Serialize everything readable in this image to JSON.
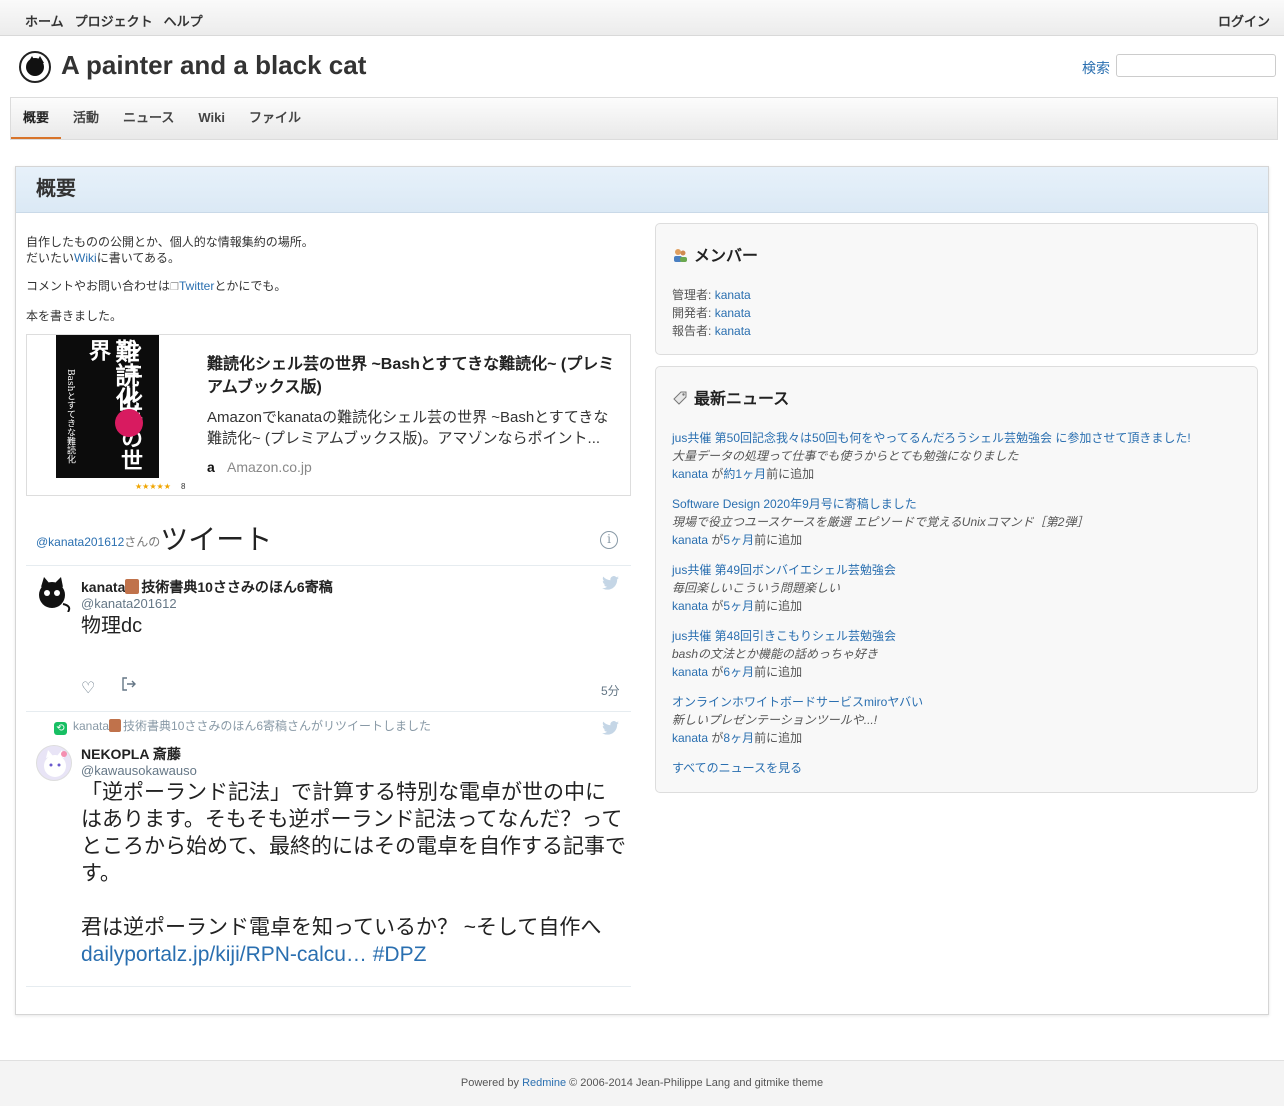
{
  "top_menu": {
    "items": [
      "ホーム",
      "プロジェクト",
      "ヘルプ"
    ],
    "login": "ログイン"
  },
  "header": {
    "title": "A painter and a black cat",
    "search_label": "検索",
    "search_value": ""
  },
  "main_menu": {
    "tabs": [
      "概要",
      "活動",
      "ニュース",
      "Wiki",
      "ファイル"
    ],
    "active": "概要"
  },
  "page": {
    "heading": "概要"
  },
  "description": {
    "line1": "自作したものの公開とか、個人的な情報集約の場所。",
    "line2_pre": "だいたい",
    "line2_link": "Wiki",
    "line2_post": "に書いてある。",
    "line3_pre": "コメントやお問い合わせは",
    "line3_link": "Twitter",
    "line3_post": "とかにでも。",
    "line4": "本を書きました。"
  },
  "book": {
    "title": "難読化シェル芸の世界 ~Bashとすてきな難読化~ (プレミアムブックス版)",
    "description": "Amazonでkanataの難読化シェル芸の世界 ~Bashとすてきな難読化~ (プレミアムブックス版)。アマゾンならポイント...",
    "source": "Amazon.co.jp",
    "cover_title": "難読化",
    "cover_title2": "シェル芸の世界",
    "cover_sub": "Bashとすてきな難読化",
    "stars": "★★★★★",
    "rating_count": "8"
  },
  "twitter": {
    "handle_link": "@kanata201612",
    "handle_suffix": "さんの",
    "title": "ツイート",
    "tweets": [
      {
        "name": "kanata",
        "name_suffix": "技術書典10ささみのほん6寄稿",
        "handle": "@kanata201612",
        "text": "物理dc",
        "time": "5分"
      },
      {
        "retweet_by": "kanata",
        "retweet_suffix": "技術書典10ささみのほん6寄稿さんがリツイートしました",
        "name": "NEKOPLA 斎藤",
        "handle": "@kawausokawauso",
        "text1": "「逆ポーランド記法」で計算する特別な電卓が世の中にはあります。そもそも逆ポーランド記法ってなんだ？ってところから始めて、最終的にはその電卓を自作する記事です。",
        "text2_pre": "君は逆ポーランド電卓を知っているか？ ~そして自作へ ",
        "text2_link": "dailyportalz.jp/kiji/RPN-calcu… #DPZ"
      }
    ]
  },
  "members": {
    "title": "メンバー",
    "rows": [
      {
        "role": "管理者:",
        "user": "kanata"
      },
      {
        "role": "開発者:",
        "user": "kanata"
      },
      {
        "role": "報告者:",
        "user": "kanata"
      }
    ]
  },
  "news": {
    "title": "最新ニュース",
    "items": [
      {
        "title": "jus共催 第50回記念我々は50回も何をやってるんだろうシェル芸勉強会 に参加させて頂きました!",
        "summary": "大量データの処理って仕事でも使うからとても勉強になりました",
        "author": "kanata",
        "mid": "が",
        "ago": "約1ヶ月",
        "post": "前に追加"
      },
      {
        "title": "Software Design 2020年9月号に寄稿しました",
        "summary": "現場で役立つユースケースを厳選 エピソードで覚えるUnixコマンド［第2弾］",
        "author": "kanata",
        "mid": "が",
        "ago": "5ヶ月",
        "post": "前に追加"
      },
      {
        "title": "jus共催 第49回ボンバイエシェル芸勉強会",
        "summary": "毎回楽しいこういう問題楽しい",
        "author": "kanata",
        "mid": "が",
        "ago": "5ヶ月",
        "post": "前に追加"
      },
      {
        "title": "jus共催 第48回引きこもりシェル芸勉強会",
        "summary": "bashの文法とか機能の話めっちゃ好き",
        "author": "kanata",
        "mid": "が",
        "ago": "6ヶ月",
        "post": "前に追加"
      },
      {
        "title": "オンラインホワイトボードサービスmiroヤバい",
        "summary": "新しいプレゼンテーションツールや...!",
        "author": "kanata",
        "mid": "が",
        "ago": "8ヶ月",
        "post": "前に追加"
      }
    ],
    "all_link": "すべてのニュースを見る"
  },
  "footer": {
    "pre": "Powered by ",
    "link": "Redmine",
    "post": " © 2006-2014 Jean-Philippe Lang and gitmike theme"
  },
  "colors": {
    "link": "#2a6fb0",
    "active_tab_underline": "#d8742a",
    "header_band": "#dbe9f5"
  }
}
